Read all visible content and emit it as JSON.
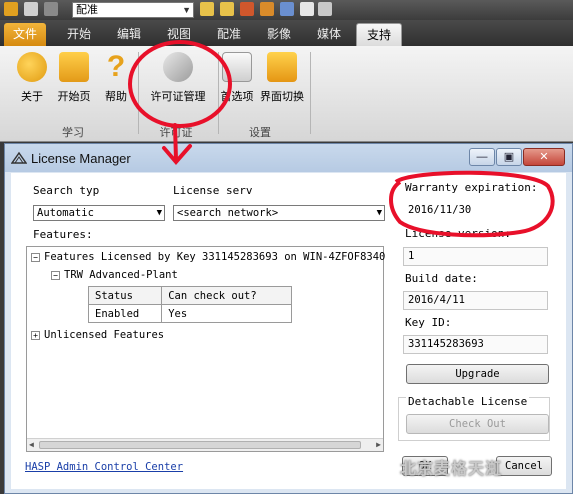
{
  "quick_access": {
    "combo_value": "配准"
  },
  "tabs": [
    "文件",
    "开始",
    "编辑",
    "视图",
    "配准",
    "影像",
    "媒体",
    "支持"
  ],
  "ribbon": {
    "buttons": [
      {
        "label": "关于",
        "icon": "about-icon"
      },
      {
        "label": "开始页",
        "icon": "home-icon"
      },
      {
        "label": "帮助",
        "icon": "help-icon"
      },
      {
        "label": "许可证管理",
        "icon": "license-key-icon"
      },
      {
        "label": "首选项",
        "icon": "preferences-icon"
      },
      {
        "label": "界面切换",
        "icon": "switch-ui-icon"
      }
    ],
    "groups": [
      "学习",
      "许可证",
      "设置"
    ]
  },
  "dialog": {
    "title": "License Manager",
    "window_buttons": {
      "minimize": "—",
      "restore": "▣",
      "close": "✕"
    },
    "search_type_label": "Search typ",
    "search_type_value": "Automatic",
    "license_server_label": "License serv",
    "license_server_value": "<search network>",
    "features_label": "Features:",
    "tree": {
      "root": "Features Licensed by Key 331145283693 on WIN-4ZFOF8340",
      "product": "TRW Advanced-Plant",
      "table_headers": [
        "Status",
        "Can check out?"
      ],
      "table_row": [
        "Enabled",
        "Yes"
      ],
      "unlicensed": "Unlicensed Features"
    },
    "warranty_label": "Warranty expiration:",
    "warranty_value": "2016/11/30",
    "license_version_label": "License version:",
    "license_version_value": "1",
    "build_date_label": "Build date:",
    "build_date_value": "2016/4/11",
    "key_id_label": "Key ID:",
    "key_id_value": "331145283693",
    "upgrade_button": "Upgrade",
    "detachable_label": "Detachable License",
    "checkout_button": "Check Out",
    "hasp_link": "HASP Admin Control Center",
    "ok_button": "OK",
    "cancel_button": "Cancel"
  },
  "watermark": "北京麦格天渱",
  "colors": {
    "annotation_red": "#e8102a",
    "file_tab": "#e39b1e",
    "link": "#1a3fa8"
  }
}
